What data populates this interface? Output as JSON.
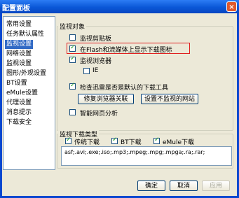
{
  "window": {
    "title": "配置面板",
    "close_glyph": "×"
  },
  "sidebar": {
    "items": [
      {
        "label": "常用设置"
      },
      {
        "label": "任务默认属性"
      },
      {
        "label": "监视设置",
        "selected": true
      },
      {
        "label": "网络设置"
      },
      {
        "label": "监视设置"
      },
      {
        "label": "图形/外观设置"
      },
      {
        "label": "BT设置"
      },
      {
        "label": "eMule设置"
      },
      {
        "label": "代理设置"
      },
      {
        "label": "消息提示"
      },
      {
        "label": "下载安全"
      }
    ]
  },
  "monitor_objects": {
    "title": "监视对象",
    "clipboard": {
      "label": "监视剪贴板",
      "checked": false
    },
    "flash": {
      "label": "在Flash和流媒体上显示下载图标",
      "checked": true
    },
    "browser": {
      "label": "监视浏览器",
      "checked": true
    },
    "ie": {
      "label": "IE",
      "checked": false
    },
    "default_tool": {
      "label": "检查迅雷是否是默认的下载工具",
      "checked": true
    },
    "repair_button": "修复浏览器关联",
    "unmonitored_sites_button": "设置不监视的网站",
    "smart_analysis": {
      "label": "智能网页分析",
      "checked": false
    }
  },
  "download_types": {
    "title": "监视下载类型",
    "traditional": {
      "label": "传统下载",
      "checked": true
    },
    "bt": {
      "label": "BT下载",
      "checked": true
    },
    "emule": {
      "label": "eMule下载",
      "checked": true
    },
    "extensions": "asf;.avi;.exe;.iso;.mp3;.mpeg;.mpg;.mpga;.ra;.rar;"
  },
  "footer": {
    "ok": "确定",
    "cancel": "取消",
    "apply": "应用"
  }
}
